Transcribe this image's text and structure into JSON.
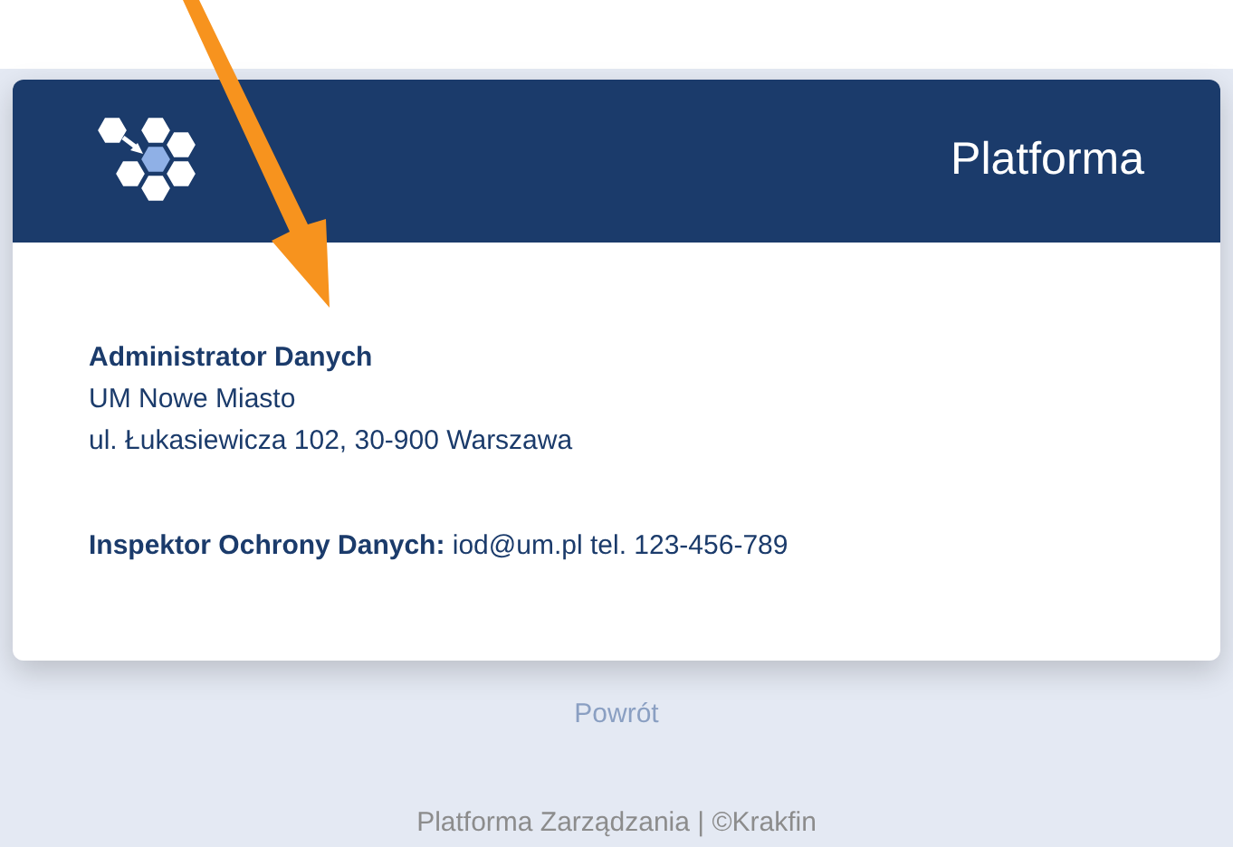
{
  "header": {
    "title": "Platforma"
  },
  "administrator": {
    "heading": "Administrator Danych",
    "lines": [
      "UM Nowe Miasto",
      "ul. Łukasiewicza 102, 30-900 Warszawa"
    ]
  },
  "inspector": {
    "text": "**Inspektor Ochrony Danych:** iod@um.pl tel. 123-456-789"
  },
  "back_link": "Powrót",
  "footer": "Platforma Zarządzania | ©Krakfin"
}
